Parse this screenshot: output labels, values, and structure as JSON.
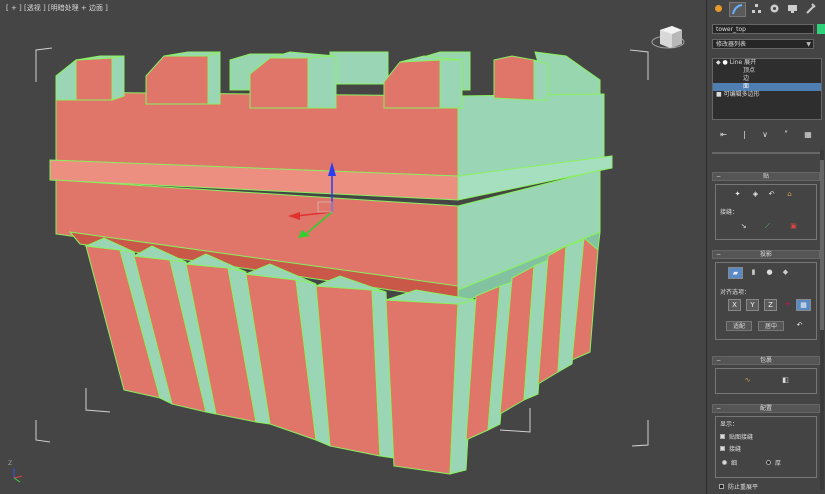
{
  "viewport": {
    "label": "[ + ] [透视 ] [明暗处理 + 边面 ]",
    "axis_label": "Z"
  },
  "panel": {
    "tabs": [
      "create-icon",
      "modify-icon",
      "hierarchy-icon",
      "motion-icon",
      "display-icon",
      "utilities-icon"
    ],
    "object_name": "tower_top",
    "object_color": "#2fd27a",
    "modifier_list": "修改器列表",
    "stack": {
      "items": [
        "Line 展开",
        "顶点",
        "边",
        "面",
        "可编辑多边形"
      ],
      "selected_index": 3
    },
    "stack_buttons": [
      "⇤",
      "|",
      "∨",
      "ʺ",
      "▦"
    ],
    "rollouts": {
      "unwrap": {
        "title": "贴",
        "section_label": "接缝：",
        "a": "面"
      },
      "projection": {
        "title": "投影",
        "align_label": "对齐选项：",
        "axes": [
          "X",
          "Y",
          "Z"
        ],
        "fit_label": "适配",
        "center_label": "居中"
      },
      "wrap": {
        "title": "包裹"
      },
      "config": {
        "title": "配置",
        "display_label": "显示：",
        "show_seams": "贴图接缝",
        "show_edges": "接缝",
        "thin": "细",
        "thick": "厚",
        "prevent": "防止重展平"
      }
    }
  }
}
